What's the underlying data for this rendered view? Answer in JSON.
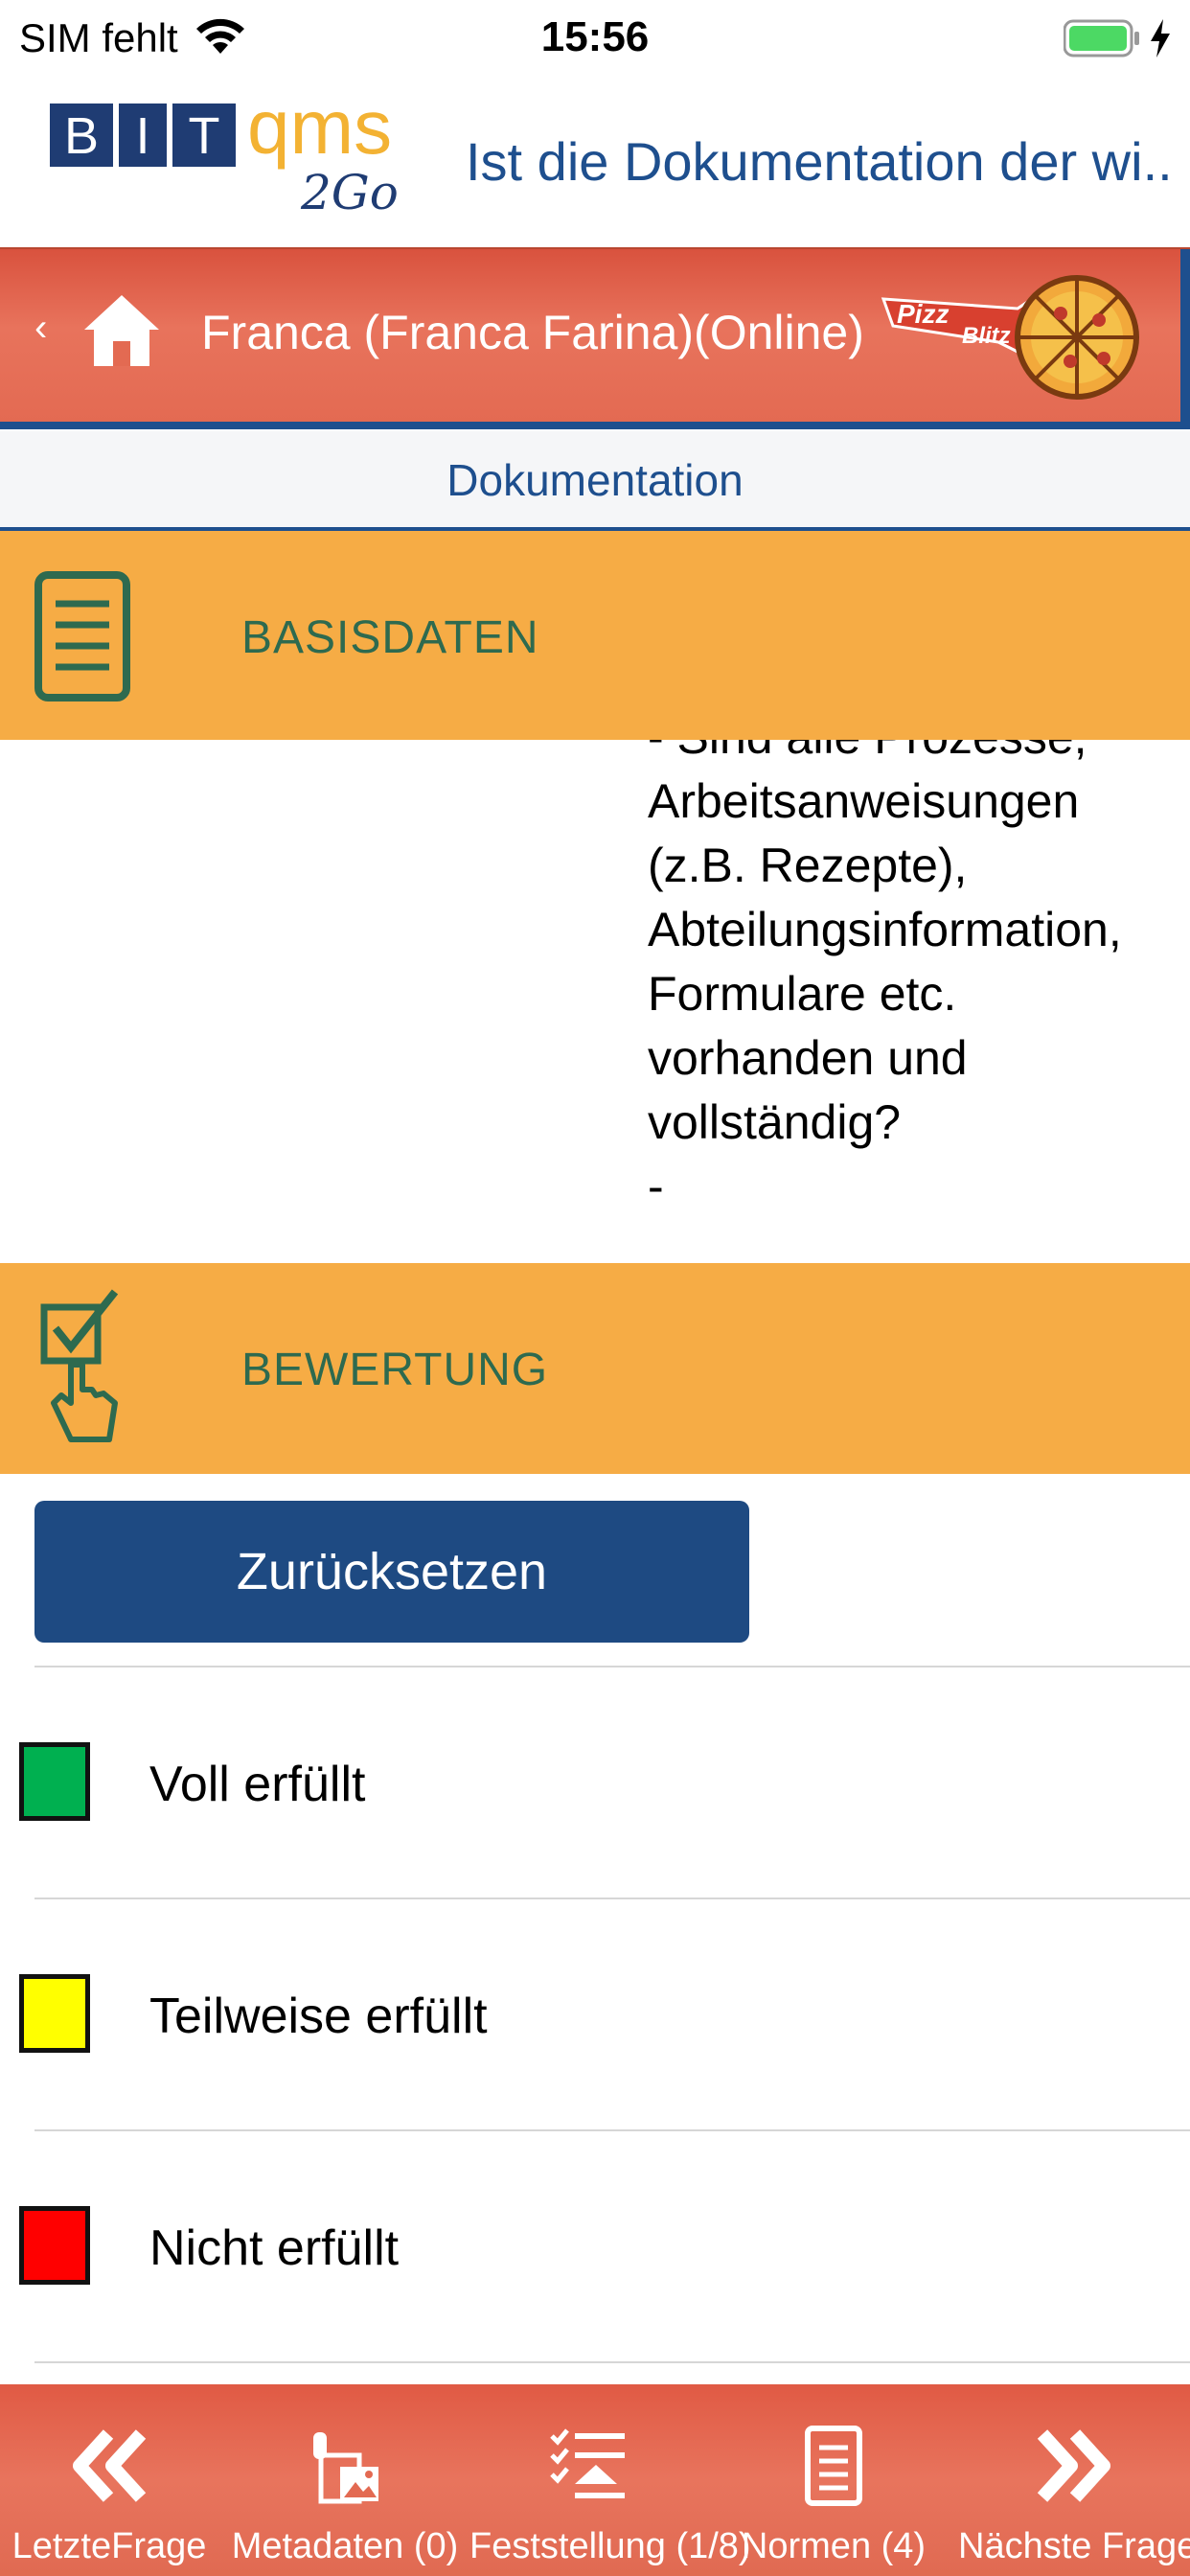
{
  "status_bar": {
    "carrier": "SIM fehlt",
    "time": "15:56"
  },
  "header": {
    "logo_text": "BIT qms 2Go",
    "title": "Ist die Dokumentation der wi..."
  },
  "nav": {
    "back_label": "‹",
    "user": "Franca (Franca Farina)(Online)",
    "brand_logo_text": "Pizza Blitz"
  },
  "tab": {
    "label": "Dokumentation"
  },
  "sections": {
    "basisdaten": "BASISDATEN",
    "bewertung": "BEWERTUNG"
  },
  "question": {
    "lines": [
      "- Sind alle Prozesse,",
      "Arbeitsanweisungen",
      "(z.B. Rezepte),",
      "Abteilungsinformation,",
      "Formulare etc.",
      "vorhanden und",
      "vollständig?",
      "-"
    ]
  },
  "rating": {
    "reset_label": "Zurücksetzen",
    "options": [
      {
        "label": "Voll erfüllt",
        "color": "#00b050"
      },
      {
        "label": "Teilweise erfüllt",
        "color": "#ffff00"
      },
      {
        "label": "Nicht erfüllt",
        "color": "#ff0000"
      }
    ]
  },
  "toolbar": {
    "items": [
      {
        "label": "LetzteFrage",
        "icon": "double-chevron-left-icon"
      },
      {
        "label": "Metadaten (0)",
        "icon": "metadata-icon"
      },
      {
        "label": "Feststellung (1/8)",
        "icon": "findings-list-icon"
      },
      {
        "label": "Normen (4)",
        "icon": "document-icon"
      },
      {
        "label": "Nächste Frage",
        "icon": "double-chevron-right-icon"
      }
    ]
  },
  "colors": {
    "accent_blue": "#1e4f8e",
    "section_orange": "#f6ac45",
    "nav_red": "#e36a52",
    "section_text_green": "#2e6a4f"
  }
}
